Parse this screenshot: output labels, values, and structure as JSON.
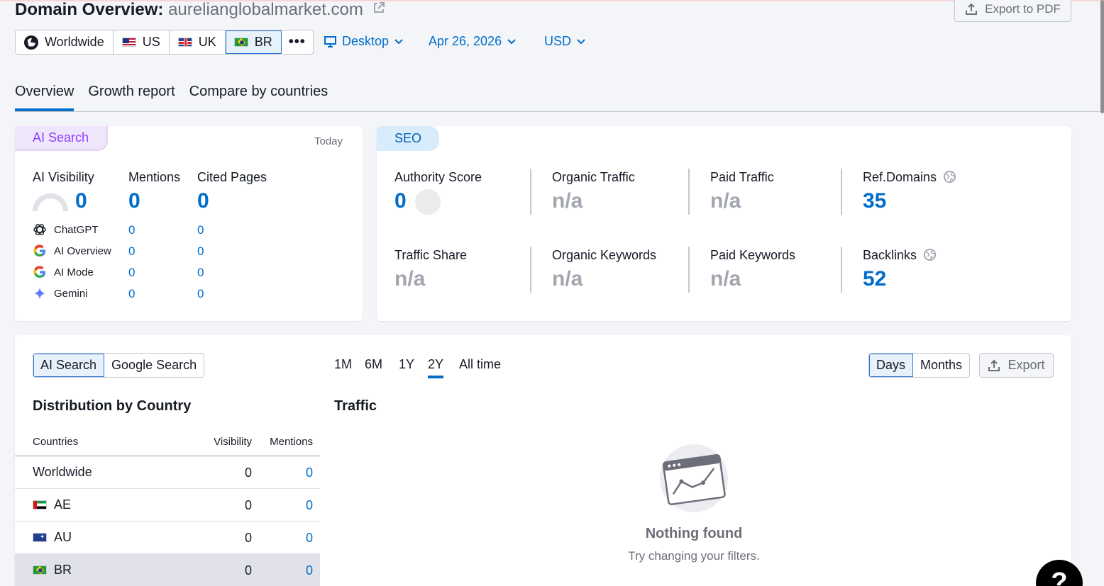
{
  "header": {
    "title": "Domain Overview:",
    "domain": "aurelianglobalmarket.com",
    "export_pdf": "Export to PDF"
  },
  "databases": [
    {
      "label": "Worldwide",
      "flag": "globe",
      "active": false
    },
    {
      "label": "US",
      "flag": "us",
      "active": false
    },
    {
      "label": "UK",
      "flag": "uk",
      "active": false
    },
    {
      "label": "BR",
      "flag": "br",
      "active": true
    }
  ],
  "filters": {
    "more": "•••",
    "device": "Desktop",
    "date": "Apr 26, 2026",
    "currency": "USD"
  },
  "tabs": [
    "Overview",
    "Growth report",
    "Compare by countries"
  ],
  "ai_search": {
    "badge": "AI Search",
    "date_label": "Today",
    "metrics": {
      "visibility_label": "AI Visibility",
      "visibility_value": "0",
      "mentions_label": "Mentions",
      "mentions_value": "0",
      "cited_label": "Cited Pages",
      "cited_value": "0"
    },
    "engines": [
      {
        "name": "ChatGPT",
        "icon": "chatgpt-icon",
        "mentions": "0",
        "cited": "0"
      },
      {
        "name": "AI Overview",
        "icon": "google-icon",
        "mentions": "0",
        "cited": "0"
      },
      {
        "name": "AI Mode",
        "icon": "google-icon",
        "mentions": "0",
        "cited": "0"
      },
      {
        "name": "Gemini",
        "icon": "gemini-icon",
        "mentions": "0",
        "cited": "0"
      }
    ]
  },
  "seo": {
    "badge": "SEO",
    "authority_label": "Authority Score",
    "authority_value": "0",
    "organic_traffic_label": "Organic Traffic",
    "organic_traffic_value": "n/a",
    "paid_traffic_label": "Paid Traffic",
    "paid_traffic_value": "n/a",
    "ref_domains_label": "Ref.Domains",
    "ref_domains_value": "35",
    "traffic_share_label": "Traffic Share",
    "traffic_share_value": "n/a",
    "organic_keywords_label": "Organic Keywords",
    "organic_keywords_value": "n/a",
    "paid_keywords_label": "Paid Keywords",
    "paid_keywords_value": "n/a",
    "backlinks_label": "Backlinks",
    "backlinks_value": "52"
  },
  "distribution": {
    "source_toggle": [
      "AI Search",
      "Google Search"
    ],
    "title": "Distribution by Country",
    "columns": [
      "Countries",
      "Visibility",
      "Mentions"
    ],
    "rows": [
      {
        "country": "Worldwide",
        "flag": "",
        "visibility": "0",
        "mentions": "0"
      },
      {
        "country": "AE",
        "flag": "ae",
        "visibility": "0",
        "mentions": "0"
      },
      {
        "country": "AU",
        "flag": "au",
        "visibility": "0",
        "mentions": "0"
      },
      {
        "country": "BR",
        "flag": "br",
        "visibility": "0",
        "mentions": "0",
        "selected": true
      }
    ]
  },
  "traffic": {
    "periods": [
      "1M",
      "6M",
      "1Y",
      "2Y",
      "All time"
    ],
    "active_period": "2Y",
    "granularity": [
      "Days",
      "Months"
    ],
    "export": "Export",
    "title": "Traffic",
    "empty_title": "Nothing found",
    "empty_subtitle": "Try changing your filters."
  },
  "help": "?",
  "colors": {
    "accent": "#006dca",
    "ai_purple": "#8a3ffc",
    "muted": "#a3a6b0"
  }
}
